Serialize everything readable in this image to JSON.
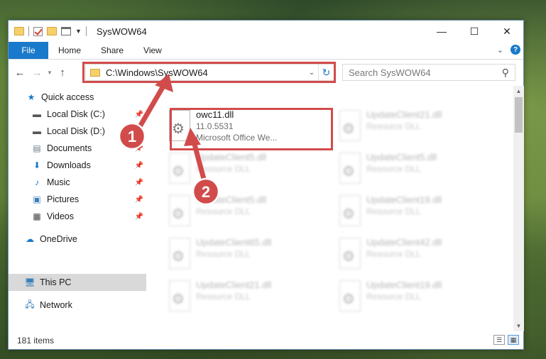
{
  "window": {
    "title": "SysWOW64"
  },
  "window_controls": {
    "minimize": "—",
    "maximize": "☐",
    "close": "✕"
  },
  "ribbon": {
    "file": "File",
    "tabs": [
      "Home",
      "Share",
      "View"
    ],
    "help": "?"
  },
  "address": {
    "path": "C:\\Windows\\SysWOW64",
    "search_placeholder": "Search SysWOW64"
  },
  "sidebar": {
    "items": [
      {
        "label": "Quick access",
        "icon": "star-icon",
        "pinned": false
      },
      {
        "label": "Local Disk (C:)",
        "icon": "drive-icon",
        "pinned": true
      },
      {
        "label": "Local Disk (D:)",
        "icon": "drive-icon",
        "pinned": true
      },
      {
        "label": "Documents",
        "icon": "documents-icon",
        "pinned": true
      },
      {
        "label": "Downloads",
        "icon": "download-icon",
        "pinned": true
      },
      {
        "label": "Music",
        "icon": "music-icon",
        "pinned": true
      },
      {
        "label": "Pictures",
        "icon": "pictures-icon",
        "pinned": true
      },
      {
        "label": "Videos",
        "icon": "videos-icon",
        "pinned": true
      },
      {
        "label": "OneDrive",
        "icon": "onedrive-icon",
        "pinned": false
      },
      {
        "label": "This PC",
        "icon": "pc-icon",
        "pinned": false,
        "selected": true
      },
      {
        "label": "Network",
        "icon": "network-icon",
        "pinned": false
      }
    ]
  },
  "files": [
    {
      "name": "owc11.dll",
      "line2": "11.0.5531",
      "line3": "Microsoft Office We...",
      "blurred": false
    },
    {
      "name": "UpdateClient21.dll",
      "line2": "Resource DLL",
      "blurred": true
    },
    {
      "name": "UpdateClient5.dll",
      "line2": "Resource DLL",
      "blurred": true
    },
    {
      "name": "UpdateClient5.dll",
      "line2": "Resource DLL",
      "blurred": true
    },
    {
      "name": "UpdateClient5.dll",
      "line2": "Resource DLL",
      "blurred": true
    },
    {
      "name": "UpdateClient19.dll",
      "line2": "Resource DLL",
      "blurred": true
    },
    {
      "name": "UpdateClient65.dll",
      "line2": "Resource DLL",
      "blurred": true
    },
    {
      "name": "UpdateClient42.dll",
      "line2": "Resource DLL",
      "blurred": true
    },
    {
      "name": "UpdateClient21.dll",
      "line2": "Resource DLL",
      "blurred": true
    },
    {
      "name": "UpdateClient19.dll",
      "line2": "Resource DLL",
      "blurred": true
    }
  ],
  "status": {
    "count": "181 items"
  },
  "annotations": {
    "step1": "1",
    "step2": "2",
    "color": "#d24b4b"
  }
}
